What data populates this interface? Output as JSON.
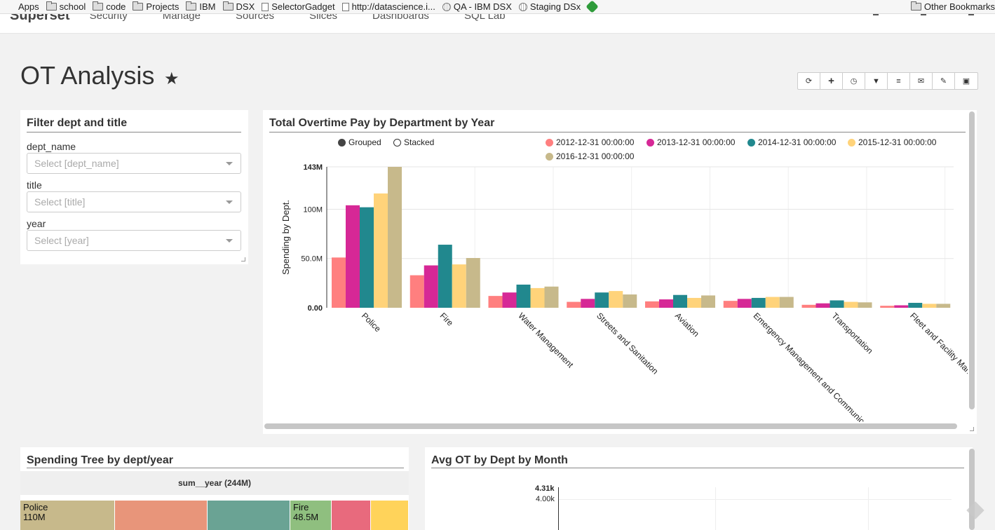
{
  "bookmarks": [
    {
      "label": "Apps",
      "icon": "apps-icon"
    },
    {
      "label": "school",
      "icon": "folder-icon"
    },
    {
      "label": "code",
      "icon": "folder-icon"
    },
    {
      "label": "Projects",
      "icon": "folder-icon"
    },
    {
      "label": "IBM",
      "icon": "folder-icon"
    },
    {
      "label": "DSX",
      "icon": "folder-icon"
    },
    {
      "label": "SelectorGadget",
      "icon": "page-icon"
    },
    {
      "label": "http://datascience.i...",
      "icon": "page-icon"
    },
    {
      "label": "QA - IBM DSX",
      "icon": "globe-icon"
    },
    {
      "label": "Staging DSx",
      "icon": "globe-icon"
    },
    {
      "label": "",
      "icon": "green-bookmark-icon"
    }
  ],
  "bookmarks_right": "Other Bookmarks",
  "navbar": {
    "brand": "Superset",
    "items": [
      "Security",
      "Manage",
      "Sources",
      "Slices",
      "Dashboards",
      "SQL Lab"
    ]
  },
  "dashboard": {
    "title": "OT Analysis",
    "toolbar": [
      "refresh-icon",
      "add-icon",
      "history-icon",
      "filter-icon",
      "css-icon",
      "email-icon",
      "edit-icon",
      "save-icon"
    ]
  },
  "filter_panel": {
    "title": "Filter dept and title",
    "fields": [
      {
        "label": "dept_name",
        "placeholder": "Select [dept_name]"
      },
      {
        "label": "title",
        "placeholder": "Select [title]"
      },
      {
        "label": "year",
        "placeholder": "Select [year]"
      }
    ]
  },
  "bar_panel": {
    "title": "Total Overtime Pay by Department by Year",
    "controls": {
      "grouped": "Grouped",
      "stacked": "Stacked"
    }
  },
  "chart_data": {
    "type": "bar",
    "title": "Total Overtime Pay by Department by Year",
    "ylabel": "Spending by Dept.",
    "ylim": [
      0,
      143
    ],
    "y_ticks": [
      {
        "value": 0,
        "label": "0.00"
      },
      {
        "value": 50,
        "label": "50.0M"
      },
      {
        "value": 100,
        "label": "100M"
      },
      {
        "value": 143,
        "label": "143M"
      }
    ],
    "categories": [
      "Police",
      "Fire",
      "Water Management",
      "Streets and Sanitation",
      "Aviation",
      "Emergency Management and Communications",
      "Transportation",
      "Fleet and Facility Management"
    ],
    "category_labels": [
      "Police",
      "Fire",
      "Water Management",
      "Streets and Sanitation",
      "Aviation",
      "Emergency Management and Communic",
      "Transportation",
      "Fleet and Facility Manag"
    ],
    "series": [
      {
        "name": "2012-12-31 00:00:00",
        "color": "#ff7f7f",
        "values": [
          51,
          33,
          12,
          6,
          6.5,
          7,
          3,
          2
        ]
      },
      {
        "name": "2013-12-31 00:00:00",
        "color": "#d62896",
        "values": [
          104,
          43,
          15.5,
          9,
          8.5,
          9,
          4.5,
          2.5
        ]
      },
      {
        "name": "2014-12-31 00:00:00",
        "color": "#21888e",
        "values": [
          102,
          64,
          23.5,
          15.5,
          13,
          10,
          7.5,
          5
        ]
      },
      {
        "name": "2015-12-31 00:00:00",
        "color": "#ffd37a",
        "values": [
          116,
          44,
          20,
          17,
          10,
          11,
          6,
          4
        ]
      },
      {
        "name": "2016-12-31 00:00:00",
        "color": "#c7b98b",
        "values": [
          143,
          50.5,
          21.5,
          13.5,
          12.5,
          11,
          5.5,
          4
        ]
      }
    ],
    "legend_position": "top-right",
    "grid": true
  },
  "tree_panel": {
    "title": "Spending Tree by dept/year",
    "header": "sum__year (244M)",
    "cells": [
      {
        "label": "Police",
        "value": "110M",
        "color": "#c7b98b"
      },
      {
        "label": "",
        "value": "",
        "color": "#e8957a"
      },
      {
        "label": "",
        "value": "",
        "color": "#6aa394"
      },
      {
        "label": "Fire",
        "value": "48.5M",
        "color": "#8fbf7f"
      },
      {
        "label": "",
        "value": "",
        "color": "#e86a7d"
      },
      {
        "label": "",
        "value": "",
        "color": "#ffd35a"
      }
    ]
  },
  "avg_panel": {
    "title": "Avg OT by Dept by Month",
    "y_ticks": [
      "4.31k",
      "4.00k"
    ]
  }
}
